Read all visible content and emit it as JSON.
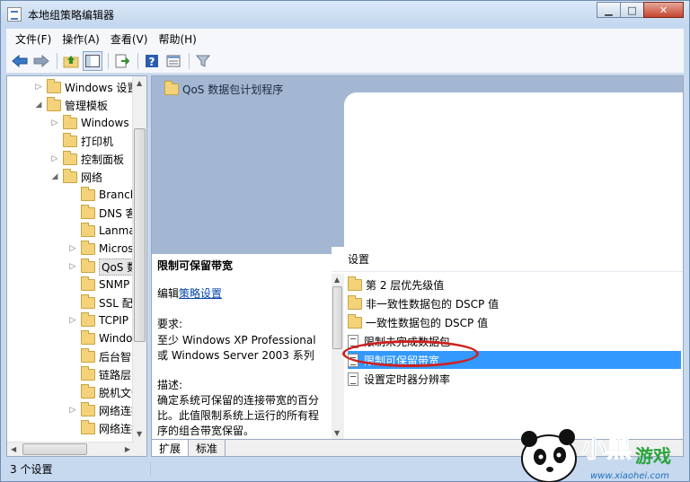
{
  "window": {
    "title": "本地组策略编辑器"
  },
  "menu": [
    "文件(F)",
    "操作(A)",
    "查看(V)",
    "帮助(H)"
  ],
  "toolbar": {
    "icons": [
      "back-arrow-icon",
      "forward-arrow-icon",
      "up-folder-icon",
      "show-hide-tree-icon",
      "export-list-icon",
      "help-icon",
      "properties-icon",
      "filter-icon"
    ]
  },
  "tree": {
    "items": [
      {
        "label": "Windows 设置",
        "arrow": "▷",
        "level": 1
      },
      {
        "label": "管理模板",
        "arrow": "◢",
        "level": 1
      },
      {
        "label": "Windows",
        "arrow": "▷",
        "level": 2
      },
      {
        "label": "打印机",
        "arrow": "",
        "level": 2
      },
      {
        "label": "控制面板",
        "arrow": "▷",
        "level": 2
      },
      {
        "label": "网络",
        "arrow": "◢",
        "level": 2
      },
      {
        "label": "BranchCache",
        "arrow": "",
        "level": 3
      },
      {
        "label": "DNS 客户端",
        "arrow": "",
        "level": 3
      },
      {
        "label": "Lanman",
        "arrow": "",
        "level": 3
      },
      {
        "label": "Microsoft",
        "arrow": "▷",
        "level": 3
      },
      {
        "label": "QoS 数据包计划程序",
        "arrow": "▷",
        "level": 3,
        "selected": true
      },
      {
        "label": "SNMP",
        "arrow": "",
        "level": 3
      },
      {
        "label": "SSL 配置",
        "arrow": "",
        "level": 3
      },
      {
        "label": "TCPIP",
        "arrow": "▷",
        "level": 3
      },
      {
        "label": "Windows",
        "arrow": "",
        "level": 3
      },
      {
        "label": "后台智能",
        "arrow": "",
        "level": 3
      },
      {
        "label": "链路层",
        "arrow": "",
        "level": 3
      },
      {
        "label": "脱机文件",
        "arrow": "",
        "level": 3
      },
      {
        "label": "网络连接",
        "arrow": "▷",
        "level": 3
      },
      {
        "label": "网络连接",
        "arrow": "",
        "level": 3
      }
    ]
  },
  "header": {
    "title": "QoS 数据包计划程序"
  },
  "description": {
    "title": "限制可保留带宽",
    "edit_prefix": "编辑",
    "edit_link": "策略设置",
    "req_label": "要求:",
    "req_line1": "至少 Windows XP Professional",
    "req_line2": "或 Windows Server 2003 系列",
    "desc_label": "描述:",
    "desc_line1": "确定系统可保留的连接带宽的百分",
    "desc_line2": "比。此值限制系统上运行的所有程",
    "desc_line3": "序的组合带宽保留。"
  },
  "list": {
    "header": "设置",
    "rows": [
      {
        "label": "第 2 层优先级值",
        "type": "folder"
      },
      {
        "label": "非一致性数据包的 DSCP 值",
        "type": "folder"
      },
      {
        "label": "一致性数据包的 DSCP 值",
        "type": "folder"
      },
      {
        "label": "限制未完成数据包",
        "type": "policy"
      },
      {
        "label": "限制可保留带宽",
        "type": "policy",
        "selected": true
      },
      {
        "label": "设置定时器分辨率",
        "type": "policy"
      }
    ]
  },
  "tabs": [
    "扩展",
    "标准"
  ],
  "status": {
    "text": "3 个设置"
  },
  "watermark": {
    "text": "小黑游戏",
    "url": "www.xiaohei.com"
  }
}
